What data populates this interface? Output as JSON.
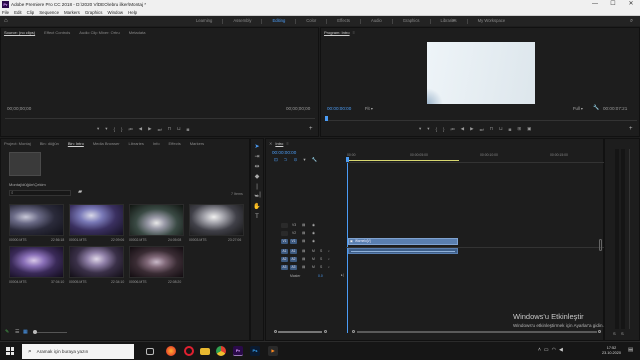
{
  "titlebar": {
    "logo_text": "Pr",
    "title": "Adobe Premiere Pro CC 2018 - D:\\2020 VİDEO\\ebru ilker\\Montaj *",
    "minimize": "—",
    "maximize": "☐",
    "close": "✕"
  },
  "menu": [
    "File",
    "Edit",
    "Clip",
    "Sequence",
    "Markers",
    "Graphics",
    "Window",
    "Help"
  ],
  "workspaces": {
    "tabs": [
      "Learning",
      "Assembly",
      "Editing",
      "Color",
      "Effects",
      "Audio",
      "Graphics",
      "Libraries",
      "My Workspace"
    ],
    "active": "Editing",
    "more": "»"
  },
  "source_panel": {
    "tabs": [
      "Source: (no clips)",
      "Effect Controls",
      "Audio Clip Mixer: Ortru",
      "Metadata"
    ],
    "timecode_left": "00;00;00;00",
    "timecode_right": "00;00;00;00"
  },
  "program_panel": {
    "tab": "Program: Intro",
    "timecode": "00:00:00:00",
    "fit": "Fit",
    "quality": "Full",
    "duration": "00:00:07:21"
  },
  "project_panel": {
    "tabs": [
      "Project: Montaj",
      "Bin: düğün",
      "Bin: Intro",
      "Media Browser",
      "Libraries",
      "Info",
      "Effects",
      "Markers"
    ],
    "active_tab": "Bin: Intro",
    "path": "Montaj\\düğün\\Çekim",
    "item_count": "7 Items",
    "clips": [
      {
        "name": "00000.MTS",
        "duration": "22:56:18"
      },
      {
        "name": "00001.MTS",
        "duration": "22:09:06"
      },
      {
        "name": "00002.MTS",
        "duration": "24:05:08"
      },
      {
        "name": "00003.MTS",
        "duration": "23:27:06"
      },
      {
        "name": "00004.MTS",
        "duration": "37:04:10"
      },
      {
        "name": "00005.MTS",
        "duration": "22:34:10"
      },
      {
        "name": "00006.MTS",
        "duration": "22:08:20"
      }
    ]
  },
  "timeline": {
    "tab": "Intro",
    "timecode": "00:00:00:00",
    "ruler": [
      "00:00",
      "00:00:05:00",
      "00:00:10:00",
      "00:00:15:00"
    ],
    "video_tracks": [
      "V3",
      "V2",
      "V1"
    ],
    "audio_tracks": [
      "A1",
      "A2",
      "A3"
    ],
    "master": "Master",
    "master_value": "0.0",
    "clip_name": "Warnelo[V]",
    "toggles": [
      "M",
      "S"
    ]
  },
  "watermark": {
    "line1": "Windows'u Etkinleştir",
    "line2": "Windows'u etkinleştirmek için Ayarlar'a gidin."
  },
  "taskbar": {
    "search_placeholder": "Aramak için buraya yazın",
    "time": "17:52",
    "date": "23.10.2020",
    "icons": {
      "premiere": "Pr",
      "photoshop": "Ps"
    }
  },
  "colors": {
    "accent_blue": "#4b9cf5",
    "clip_blue": "#5a7fb0",
    "workarea_yellow": "#d8d870",
    "background": "#1d1d1d"
  }
}
